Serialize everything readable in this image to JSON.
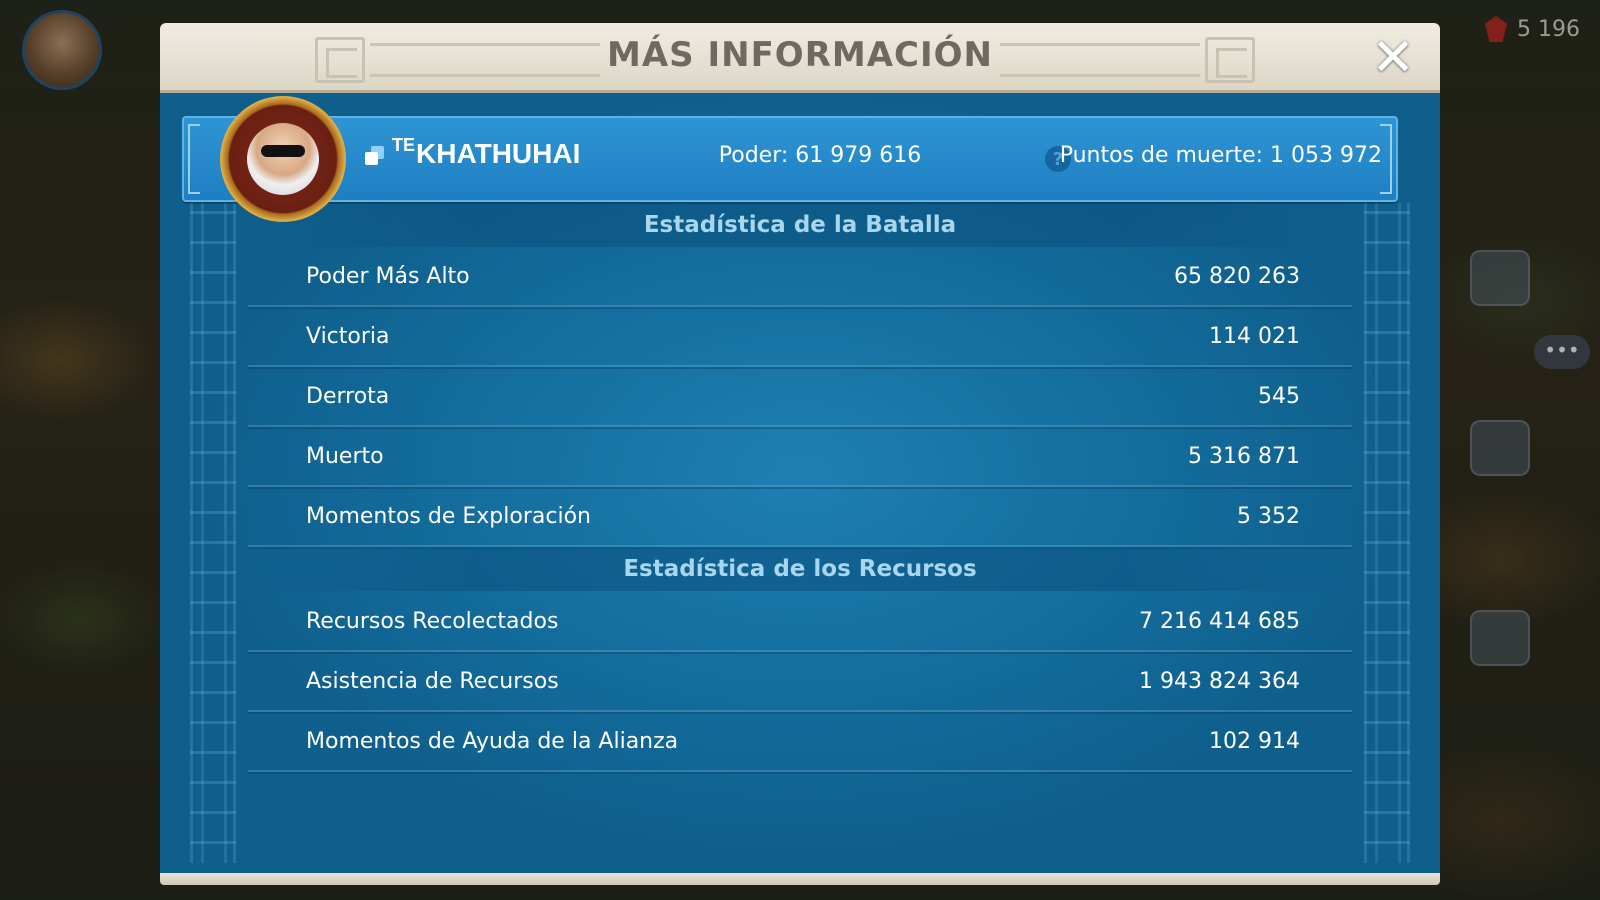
{
  "background": {
    "gem_count": "5 196"
  },
  "dialog": {
    "title": "MÁS INFORMACIÓN",
    "close_label": "✕"
  },
  "player": {
    "alliance_tag": "TE",
    "name": "KHATHUHAI",
    "power_text": "Poder: 61 979 616",
    "death_points_text": "Puntos de muerte: 1 053 972",
    "help_label": "?"
  },
  "battle_stats": {
    "heading": "Estadística de la Batalla",
    "rows": [
      {
        "label": "Poder Más Alto",
        "value": "65 820 263"
      },
      {
        "label": "Victoria",
        "value": "114 021"
      },
      {
        "label": "Derrota",
        "value": "545"
      },
      {
        "label": "Muerto",
        "value": "5 316 871"
      },
      {
        "label": "Momentos de Exploración",
        "value": "5 352"
      }
    ]
  },
  "resource_stats": {
    "heading": "Estadística de los Recursos",
    "rows": [
      {
        "label": "Recursos Recolectados",
        "value": "7 216 414 685"
      },
      {
        "label": "Asistencia de Recursos",
        "value": "1 943 824 364"
      },
      {
        "label": "Momentos de Ayuda de la Alianza",
        "value": "102 914"
      }
    ]
  },
  "colors": {
    "panel_blue": "#136c9c",
    "player_bar_blue": "#2f94d4",
    "header_cream": "#f1ede3",
    "section_text": "#a8d6ee"
  },
  "icons": {
    "close": "close-icon",
    "share": "share-icon",
    "help": "help-icon",
    "gem": "gem-icon"
  }
}
